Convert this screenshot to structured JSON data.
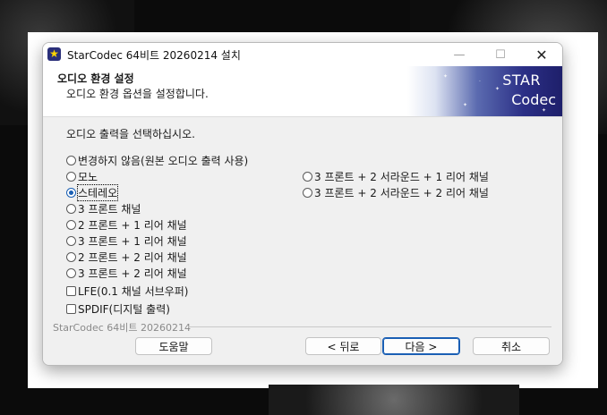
{
  "window": {
    "title": "StarCodec 64비트 20260214 설치",
    "controls": {
      "minimize": "—",
      "maximize": "☐",
      "close": "✕"
    }
  },
  "header": {
    "title": "오디오 환경 설정",
    "subtitle": "오디오 환경 옵션을 설정합니다.",
    "banner": {
      "line1": "STAR",
      "line2": "Codec"
    }
  },
  "body": {
    "prompt": "오디오 출력을 선택하십시오.",
    "radio_options_left": [
      {
        "label": "변경하지 않음(원본 오디오 출력 사용)",
        "selected": false
      },
      {
        "label": "모노",
        "selected": false
      },
      {
        "label": "스테레오",
        "selected": true
      },
      {
        "label": "3 프론트 채널",
        "selected": false
      },
      {
        "label": "2 프론트 + 1 리어 채널",
        "selected": false
      },
      {
        "label": "3 프론트 + 1 리어 채널",
        "selected": false
      },
      {
        "label": "2 프론트 + 2 리어 채널",
        "selected": false
      },
      {
        "label": "3 프론트 + 2 리어 채널",
        "selected": false
      }
    ],
    "radio_options_right": [
      {
        "label": "3 프론트 + 2 서라운드 + 1 리어 채널",
        "selected": false
      },
      {
        "label": "3 프론트 + 2 서라운드 + 2 리어 채널",
        "selected": false
      }
    ],
    "checkboxes": [
      {
        "label": "LFE(0.1 채널 서브우퍼)",
        "checked": false
      },
      {
        "label": "SPDIF(디지털 출력)",
        "checked": false
      }
    ]
  },
  "footer": {
    "brand": "StarCodec 64비트 20260214",
    "buttons": {
      "help": "도움말",
      "back": "< 뒤로",
      "next": "다음 >",
      "cancel": "취소"
    }
  },
  "colors": {
    "accent": "#1a5fb4",
    "banner_dark": "#1e1f6a",
    "panel_bg": "#f0f0f0"
  }
}
